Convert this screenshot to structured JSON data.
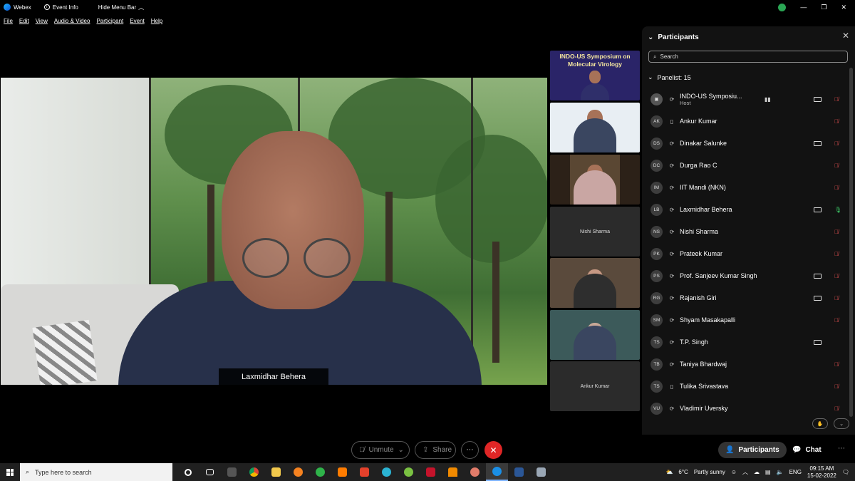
{
  "titlebar": {
    "app_name": "Webex",
    "event_info": "Event Info",
    "hide_menu": "Hide Menu Bar"
  },
  "menu": [
    "File",
    "Edit",
    "View",
    "Audio & Video",
    "Participant",
    "Event",
    "Help"
  ],
  "main_video": {
    "speaker_name": "Laxmidhar Behera"
  },
  "filmstrip": {
    "poster_title_line1": "INDO-US Symposium on",
    "poster_title_line2": "Molecular Virology",
    "name_tile_1": "Nishi Sharma",
    "name_tile_2": "Ankur Kumar"
  },
  "panel": {
    "title": "Participants",
    "search_placeholder": "Search",
    "panelist_header": "Panelist: 15",
    "participants": [
      {
        "initials": "",
        "name": "INDO-US Symposiu...",
        "role": "Host",
        "device": "phone",
        "camera": true,
        "mic": "muted",
        "level": true
      },
      {
        "initials": "AK",
        "name": "Ankur Kumar",
        "role": "",
        "device": "mobile",
        "camera": false,
        "mic": "muted"
      },
      {
        "initials": "DS",
        "name": "Dinakar Salunke",
        "role": "",
        "device": "phone",
        "camera": true,
        "mic": "muted"
      },
      {
        "initials": "DC",
        "name": "Durga Rao C",
        "role": "",
        "device": "phone",
        "camera": false,
        "mic": "muted"
      },
      {
        "initials": "IM",
        "name": "IIT Mandi (NKN)",
        "role": "",
        "device": "phone",
        "camera": false,
        "mic": "muted"
      },
      {
        "initials": "LB",
        "name": "Laxmidhar Behera",
        "role": "",
        "device": "phone",
        "camera": true,
        "mic": "live"
      },
      {
        "initials": "NS",
        "name": "Nishi Sharma",
        "role": "",
        "device": "phone",
        "camera": false,
        "mic": "muted"
      },
      {
        "initials": "PK",
        "name": "Prateek Kumar",
        "role": "",
        "device": "phone",
        "camera": false,
        "mic": "muted"
      },
      {
        "initials": "PS",
        "name": "Prof. Sanjeev Kumar Singh",
        "role": "",
        "device": "phone",
        "camera": true,
        "mic": "muted"
      },
      {
        "initials": "RG",
        "name": "Rajanish Giri",
        "role": "",
        "device": "phone",
        "camera": true,
        "mic": "muted"
      },
      {
        "initials": "SM",
        "name": "Shyam Masakapalli",
        "role": "",
        "device": "phone",
        "camera": false,
        "mic": "muted"
      },
      {
        "initials": "TS",
        "name": "T.P. Singh",
        "role": "",
        "device": "phone",
        "camera": true,
        "mic": "none"
      },
      {
        "initials": "TB",
        "name": "Taniya Bhardwaj",
        "role": "",
        "device": "phone",
        "camera": false,
        "mic": "muted"
      },
      {
        "initials": "TS",
        "name": "Tulika Srivastava",
        "role": "",
        "device": "mobile",
        "camera": false,
        "mic": "muted"
      },
      {
        "initials": "VU",
        "name": "Vladimir Uversky",
        "role": "",
        "device": "phone",
        "camera": false,
        "mic": "muted"
      }
    ]
  },
  "controls": {
    "unmute": "Unmute",
    "share": "Share",
    "participants": "Participants",
    "chat": "Chat"
  },
  "taskbar": {
    "search_placeholder": "Type here to search",
    "weather_temp": "6°C",
    "weather_desc": "Partly sunny",
    "language": "ENG",
    "time": "09:15 AM",
    "date": "15-02-2022"
  },
  "colors": {
    "leave_red": "#e02626",
    "muted_red": "#f05555",
    "live_green": "#3fcf6a"
  }
}
